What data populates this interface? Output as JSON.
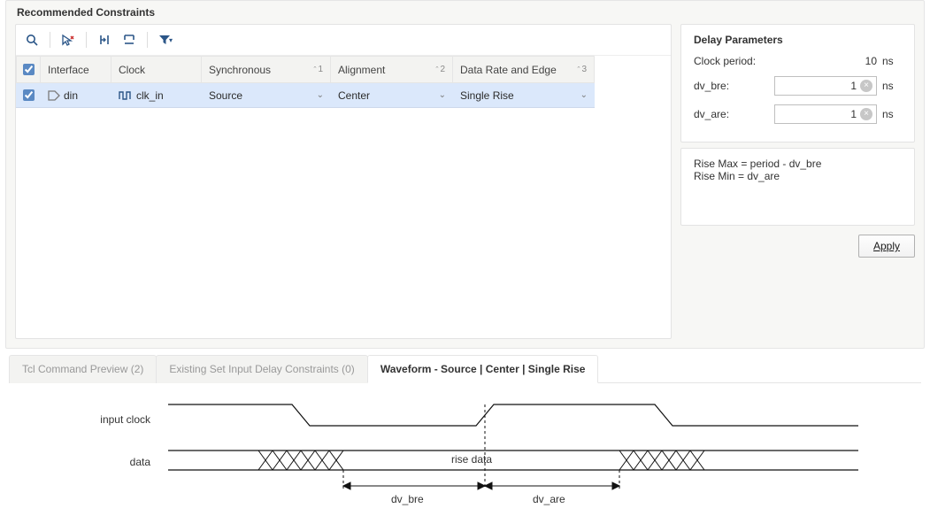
{
  "panel": {
    "title": "Recommended Constraints"
  },
  "toolbar": {
    "search_tip": "Search",
    "cursor_tip": "Cursor",
    "collapse_tip": "Collapse",
    "expand_tip": "Expand",
    "filter_tip": "Filter"
  },
  "table": {
    "headers": {
      "checkbox": "",
      "interface": "Interface",
      "clock": "Clock",
      "synchronous": "Synchronous",
      "alignment": "Alignment",
      "data_rate": "Data Rate and Edge"
    },
    "sort": {
      "synchronous": "1",
      "alignment": "2",
      "data_rate": "3"
    },
    "row": {
      "checked": true,
      "interface": "din",
      "clock": "clk_in",
      "synchronous": "Source",
      "alignment": "Center",
      "data_rate": "Single Rise"
    }
  },
  "delay": {
    "title": "Delay Parameters",
    "clock_period_label": "Clock period:",
    "clock_period_value": "10",
    "unit": "ns",
    "dv_bre_label": "dv_bre:",
    "dv_bre_value": "1",
    "dv_are_label": "dv_are:",
    "dv_are_value": "1"
  },
  "formulas": {
    "line1": "Rise Max = period - dv_bre",
    "line2": "Rise Min = dv_are"
  },
  "apply": {
    "label": "Apply"
  },
  "tabs": {
    "tcl": "Tcl Command Preview (2)",
    "existing": "Existing Set Input Delay Constraints (0)",
    "waveform": "Waveform - Source | Center | Single Rise"
  },
  "waveform": {
    "input_clock_label": "input clock",
    "data_label": "data",
    "rise_data_label": "rise data",
    "dv_bre_label": "dv_bre",
    "dv_are_label": "dv_are"
  }
}
